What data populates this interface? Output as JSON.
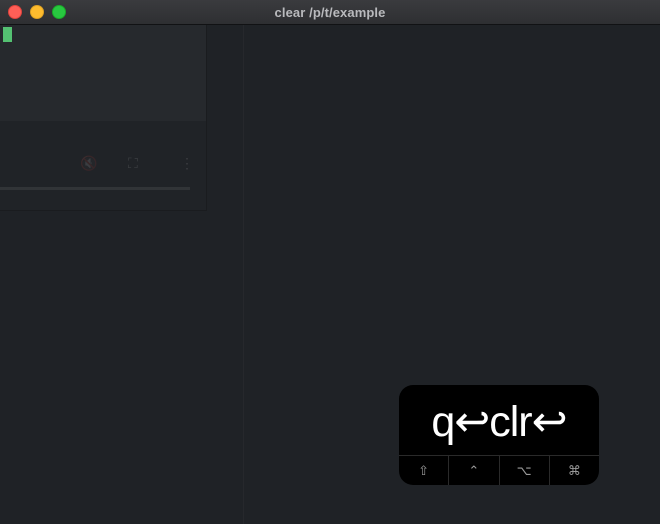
{
  "window": {
    "title": "clear /p/t/example"
  },
  "keycast": {
    "keys": "q↩clr↩",
    "modifiers": [
      {
        "symbol": "⇧",
        "name": "shift"
      },
      {
        "symbol": "⌃",
        "name": "control"
      },
      {
        "symbol": "⌥",
        "name": "option"
      },
      {
        "symbol": "⌘",
        "name": "command"
      }
    ]
  },
  "colors": {
    "cursor": "#4fbf6e",
    "terminal_bg": "#1f2226",
    "overlay_bg": "#000000"
  }
}
